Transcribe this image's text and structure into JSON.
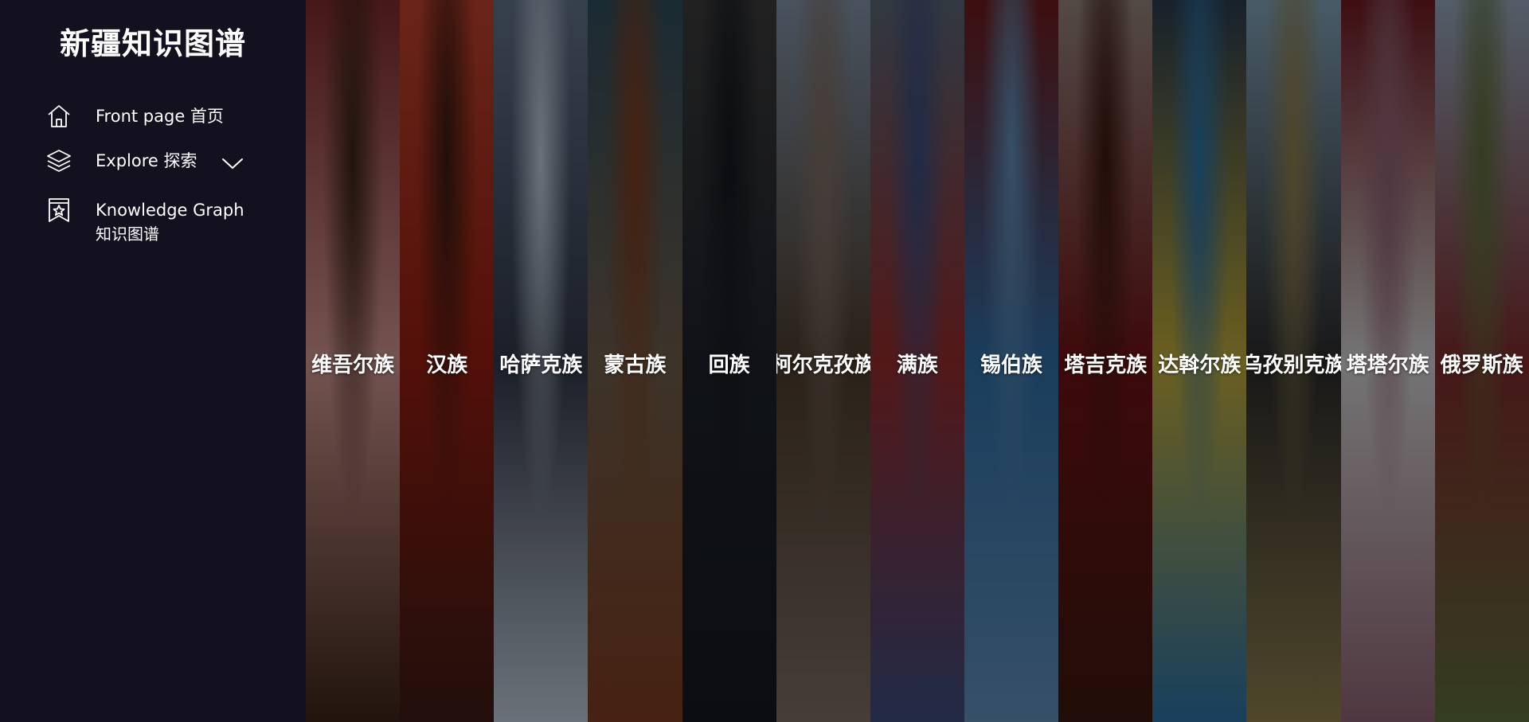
{
  "sidebar": {
    "title": "新疆知识图谱",
    "nav": {
      "home": {
        "label": "Front page 首页",
        "icon": "home-icon"
      },
      "explore": {
        "label": "Explore 探索",
        "icon": "layers-icon",
        "toggle_icon": "chevron-down-icon"
      },
      "knowledge_graph": {
        "label": "Knowledge Graph",
        "sublabel": "知识图谱",
        "icon": "bookmark-star-icon"
      }
    }
  },
  "ethnic_groups": [
    {
      "name": "维吾尔族",
      "colors": [
        "#7a2a2a",
        "#c8908a",
        "#3a2418"
      ]
    },
    {
      "name": "汉族",
      "colors": [
        "#b8402a",
        "#8f1c10",
        "#3a1a14"
      ]
    },
    {
      "name": "哈萨克族",
      "colors": [
        "#5f6f86",
        "#2f3646",
        "#b9c3d2"
      ]
    },
    {
      "name": "蒙古族",
      "colors": [
        "#2e4a58",
        "#6a5a48",
        "#7a3a1e"
      ]
    },
    {
      "name": "回族",
      "colors": [
        "#3a3a3a",
        "#1c2028",
        "#15181e"
      ]
    },
    {
      "name": "柯尔克孜族",
      "colors": [
        "#7d8ea2",
        "#4a3a2a",
        "#7a6a60"
      ]
    },
    {
      "name": "满族",
      "colors": [
        "#566270",
        "#8e2a2a",
        "#3a4a7a"
      ]
    },
    {
      "name": "锡伯族",
      "colors": [
        "#6a1a1a",
        "#2e6aa0",
        "#5d8ab2"
      ]
    },
    {
      "name": "塔吉克族",
      "colors": [
        "#8e7f78",
        "#6a1212",
        "#3a1810"
      ]
    },
    {
      "name": "达斡尔族",
      "colors": [
        "#2a3a4a",
        "#b8a438",
        "#2a6ea0"
      ]
    },
    {
      "name": "乌孜别克族",
      "colors": [
        "#7d9db2",
        "#2a2a2a",
        "#8a7a4a"
      ]
    },
    {
      "name": "塔塔尔族",
      "colors": [
        "#6a1a20",
        "#c9c9c9",
        "#8a6070"
      ]
    },
    {
      "name": "俄罗斯族",
      "colors": [
        "#8ea0b2",
        "#7a2a2a",
        "#5a6a3a"
      ]
    }
  ]
}
